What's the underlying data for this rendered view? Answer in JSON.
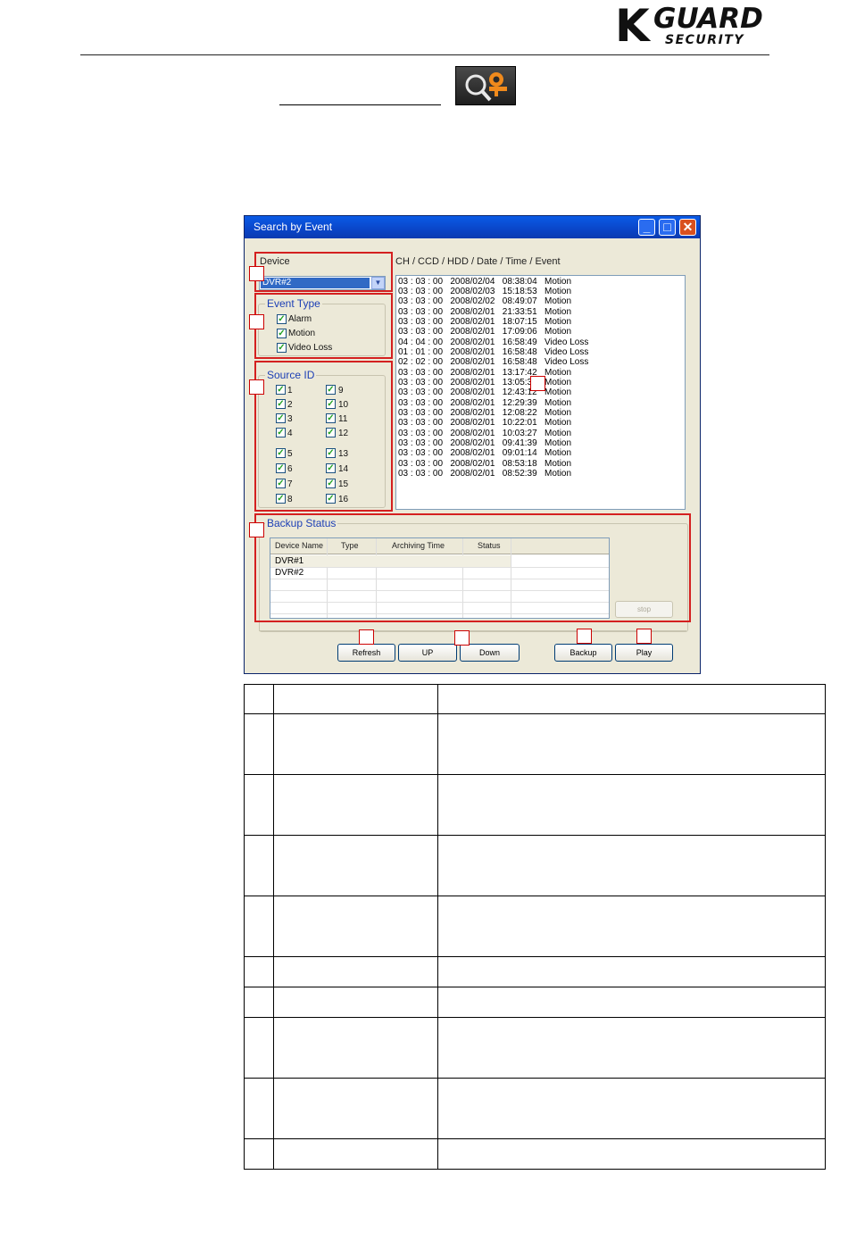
{
  "header": {
    "logo_k": "K",
    "logo_guard": "GUARD",
    "logo_security": "SECURITY",
    "search_icon": "magnifier-camera-icon"
  },
  "window": {
    "title": "Search by Event",
    "device_label": "Device",
    "device_selected": "DVR#2",
    "list_header": "CH / CCD / HDD / Date / Time / Event",
    "event_type": {
      "label": "Event Type",
      "options": [
        {
          "label": "Alarm",
          "checked": true
        },
        {
          "label": "Motion",
          "checked": true
        },
        {
          "label": "Video Loss",
          "checked": true
        }
      ]
    },
    "source_id": {
      "label": "Source ID",
      "left": [
        "1",
        "2",
        "3",
        "4",
        "5",
        "6",
        "7",
        "8"
      ],
      "right": [
        "9",
        "10",
        "11",
        "12",
        "13",
        "14",
        "15",
        "16"
      ]
    },
    "events": [
      "03 : 03 : 00   2008/02/04   08:38:04   Motion",
      "03 : 03 : 00   2008/02/03   15:18:53   Motion",
      "03 : 03 : 00   2008/02/02   08:49:07   Motion",
      "03 : 03 : 00   2008/02/01   21:33:51   Motion",
      "03 : 03 : 00   2008/02/01   18:07:15   Motion",
      "03 : 03 : 00   2008/02/01   17:09:06   Motion",
      "04 : 04 : 00   2008/02/01   16:58:49   Video Loss",
      "01 : 01 : 00   2008/02/01   16:58:48   Video Loss",
      "02 : 02 : 00   2008/02/01   16:58:48   Video Loss",
      "03 : 03 : 00   2008/02/01   13:17:42   Motion",
      "03 : 03 : 00   2008/02/01   13:05:34   Motion",
      "03 : 03 : 00   2008/02/01   12:43:12   Motion",
      "03 : 03 : 00   2008/02/01   12:29:39   Motion",
      "03 : 03 : 00   2008/02/01   12:08:22   Motion",
      "03 : 03 : 00   2008/02/01   10:22:01   Motion",
      "03 : 03 : 00   2008/02/01   10:03:27   Motion",
      "03 : 03 : 00   2008/02/01   09:41:39   Motion",
      "03 : 03 : 00   2008/02/01   09:01:14   Motion",
      "03 : 03 : 00   2008/02/01   08:53:18   Motion",
      "03 : 03 : 00   2008/02/01   08:52:39   Motion"
    ],
    "backup_status": {
      "label": "Backup Status",
      "columns": [
        "Device Name",
        "Type",
        "Archiving Time",
        "Status"
      ],
      "rows": [
        "DVR#1",
        "DVR#2"
      ],
      "stop_label": "stop"
    },
    "buttons": {
      "refresh": "Refresh",
      "up": "UP",
      "down": "Down",
      "backup": "Backup",
      "play": "Play"
    }
  }
}
